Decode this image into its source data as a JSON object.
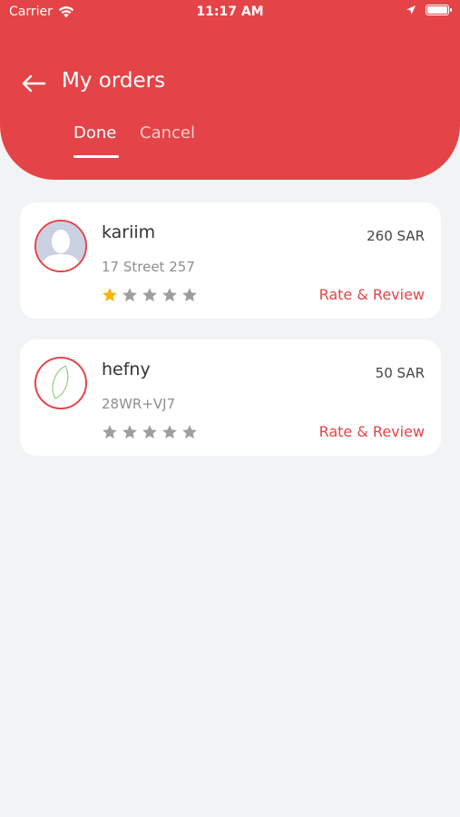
{
  "status_bar": {
    "carrier": "Carrier",
    "time": "11:17 AM"
  },
  "header": {
    "title": "My orders"
  },
  "tabs": [
    {
      "label": "Done",
      "active": true
    },
    {
      "label": "Cancel",
      "active": false
    }
  ],
  "orders": [
    {
      "name": "kariim",
      "address": "17 Street 257",
      "price": "260 SAR",
      "rating": 1,
      "max_rating": 5,
      "action": "Rate & Review"
    },
    {
      "name": "hefny",
      "address": "28WR+VJ7",
      "price": "50 SAR",
      "rating": 0,
      "max_rating": 5,
      "action": "Rate & Review"
    }
  ],
  "colors": {
    "accent": "#e44447",
    "background": "#f2f3f5",
    "star_filled": "#f5b50a",
    "star_empty": "#9e9e9e"
  }
}
